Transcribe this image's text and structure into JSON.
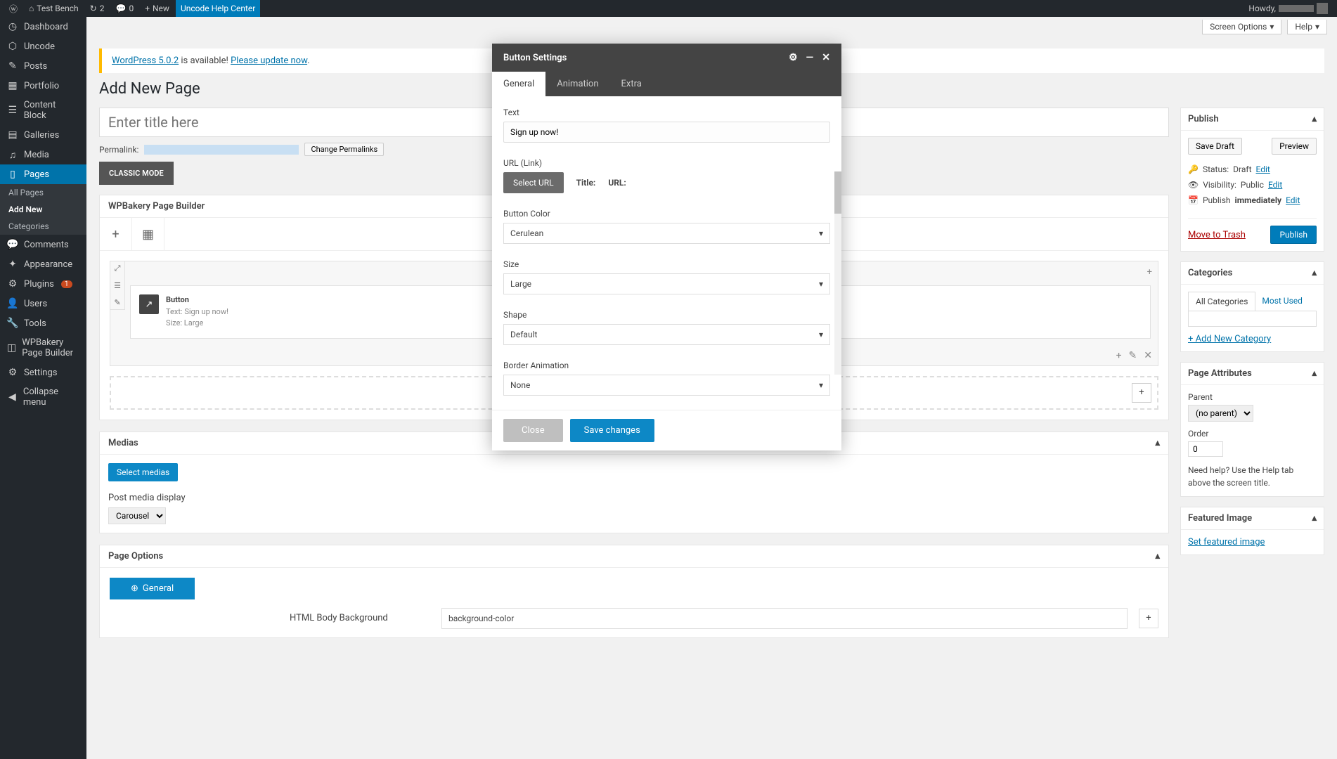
{
  "adminbar": {
    "site": "Test Bench",
    "updates": "2",
    "comments": "0",
    "new": "New",
    "help_center": "Uncode Help Center",
    "howdy": "Howdy,"
  },
  "sidebar": {
    "items": [
      {
        "icon": "◷",
        "label": "Dashboard"
      },
      {
        "icon": "⬡",
        "label": "Uncode"
      },
      {
        "icon": "✎",
        "label": "Posts"
      },
      {
        "icon": "▦",
        "label": "Portfolio"
      },
      {
        "icon": "☰",
        "label": "Content Block"
      },
      {
        "icon": "▤",
        "label": "Galleries"
      },
      {
        "icon": "♫",
        "label": "Media"
      },
      {
        "icon": "▯",
        "label": "Pages",
        "active": true
      },
      {
        "icon": "💬",
        "label": "Comments"
      },
      {
        "icon": "✦",
        "label": "Appearance"
      },
      {
        "icon": "⚙",
        "label": "Plugins",
        "badge": "1"
      },
      {
        "icon": "👤",
        "label": "Users"
      },
      {
        "icon": "🔧",
        "label": "Tools"
      },
      {
        "icon": "◫",
        "label": "WPBakery Page Builder"
      },
      {
        "icon": "⚙",
        "label": "Settings"
      },
      {
        "icon": "◀",
        "label": "Collapse menu"
      }
    ],
    "pages_sub": [
      "All Pages",
      "Add New",
      "Categories"
    ]
  },
  "screen_options": {
    "screen": "Screen Options",
    "help": "Help"
  },
  "notice": {
    "prefix": "WordPress 5.0.2",
    "middle": " is available! ",
    "link": "Please update now"
  },
  "page_title": "Add New Page",
  "title_placeholder": "Enter title here",
  "permalink": {
    "label": "Permalink:",
    "btn": "Change Permalinks"
  },
  "classic_mode": "CLASSIC MODE",
  "wpb": {
    "title": "WPBakery Page Builder",
    "element": {
      "name": "Button",
      "text": "Text: Sign up now!",
      "size": "Size: Large"
    }
  },
  "medias": {
    "title": "Medias",
    "select": "Select medias",
    "display_label": "Post media display",
    "display_value": "Carousel"
  },
  "page_options": {
    "title": "Page Options",
    "general": "General",
    "bg_label": "HTML Body Background",
    "bg_value": "background-color"
  },
  "publish": {
    "title": "Publish",
    "save": "Save Draft",
    "preview": "Preview",
    "status_l": "Status:",
    "status_v": "Draft",
    "edit": "Edit",
    "vis_l": "Visibility:",
    "vis_v": "Public",
    "pub_l": "Publish",
    "pub_v": "immediately",
    "trash": "Move to Trash",
    "publish": "Publish"
  },
  "categories": {
    "title": "Categories",
    "all": "All Categories",
    "most": "Most Used",
    "add": "+ Add New Category"
  },
  "attrs": {
    "title": "Page Attributes",
    "parent_l": "Parent",
    "parent_v": "(no parent)",
    "order_l": "Order",
    "order_v": "0",
    "help": "Need help? Use the Help tab above the screen title."
  },
  "featured": {
    "title": "Featured Image",
    "set": "Set featured image"
  },
  "modal": {
    "title": "Button Settings",
    "tabs": [
      "General",
      "Animation",
      "Extra"
    ],
    "text_l": "Text",
    "text_v": "Sign up now!",
    "url_l": "URL (Link)",
    "select_url": "Select URL",
    "title_l": "Title:",
    "url_tl": "URL:",
    "color_l": "Button Color",
    "color_v": "Cerulean",
    "size_l": "Size",
    "size_v": "Large",
    "shape_l": "Shape",
    "shape_v": "Default",
    "border_l": "Border Animation",
    "border_v": "None",
    "close": "Close",
    "save": "Save changes"
  }
}
